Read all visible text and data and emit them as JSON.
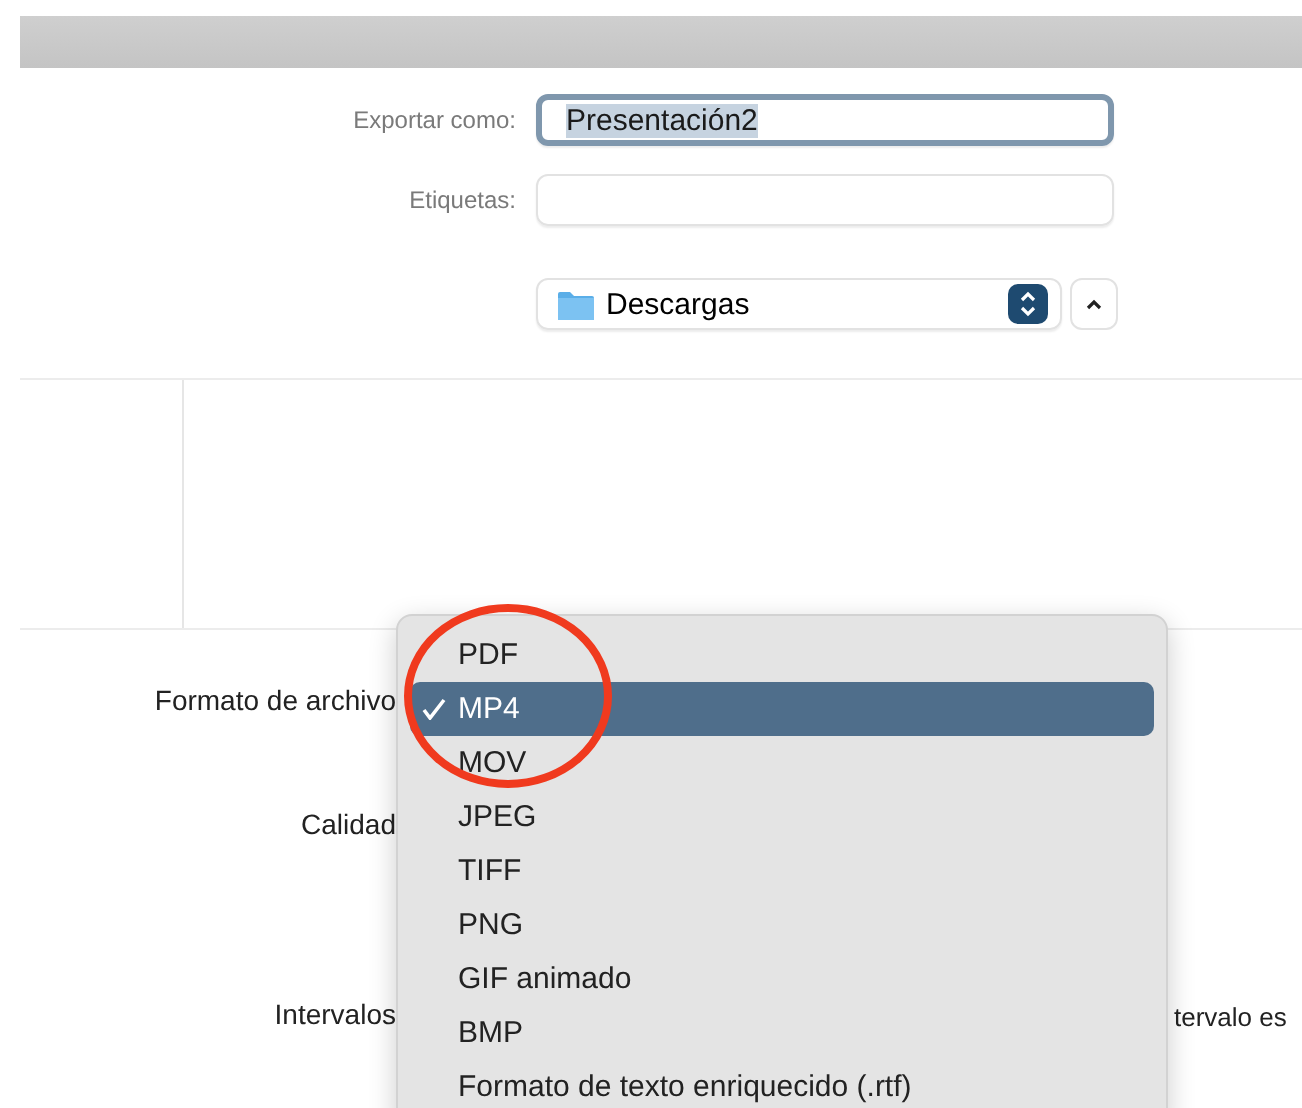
{
  "form": {
    "fields": [
      {
        "label": "Exportar como:",
        "value": "Presentación2",
        "focused": true
      },
      {
        "label": "Etiquetas:",
        "focused": false
      }
    ],
    "location": {
      "value": "Descargas"
    }
  },
  "options": {
    "labels": [
      {
        "text": "Formato de archivo"
      },
      {
        "text": "Calidad"
      },
      {
        "text": "Intervalos"
      }
    ],
    "side_text": "tervalo es"
  },
  "format_menu": {
    "items": [
      {
        "label": "PDF",
        "selected": false
      },
      {
        "label": "MP4",
        "selected": true
      },
      {
        "label": "MOV",
        "selected": false
      },
      {
        "label": "JPEG",
        "selected": false
      },
      {
        "label": "TIFF",
        "selected": false
      },
      {
        "label": "PNG",
        "selected": false
      },
      {
        "label": "GIF animado",
        "selected": false
      },
      {
        "label": "BMP",
        "selected": false
      },
      {
        "label": "Formato de texto enriquecido (.rtf)",
        "selected": false
      }
    ]
  },
  "annotation": {
    "kind": "circle",
    "color": "#f03a1e"
  }
}
